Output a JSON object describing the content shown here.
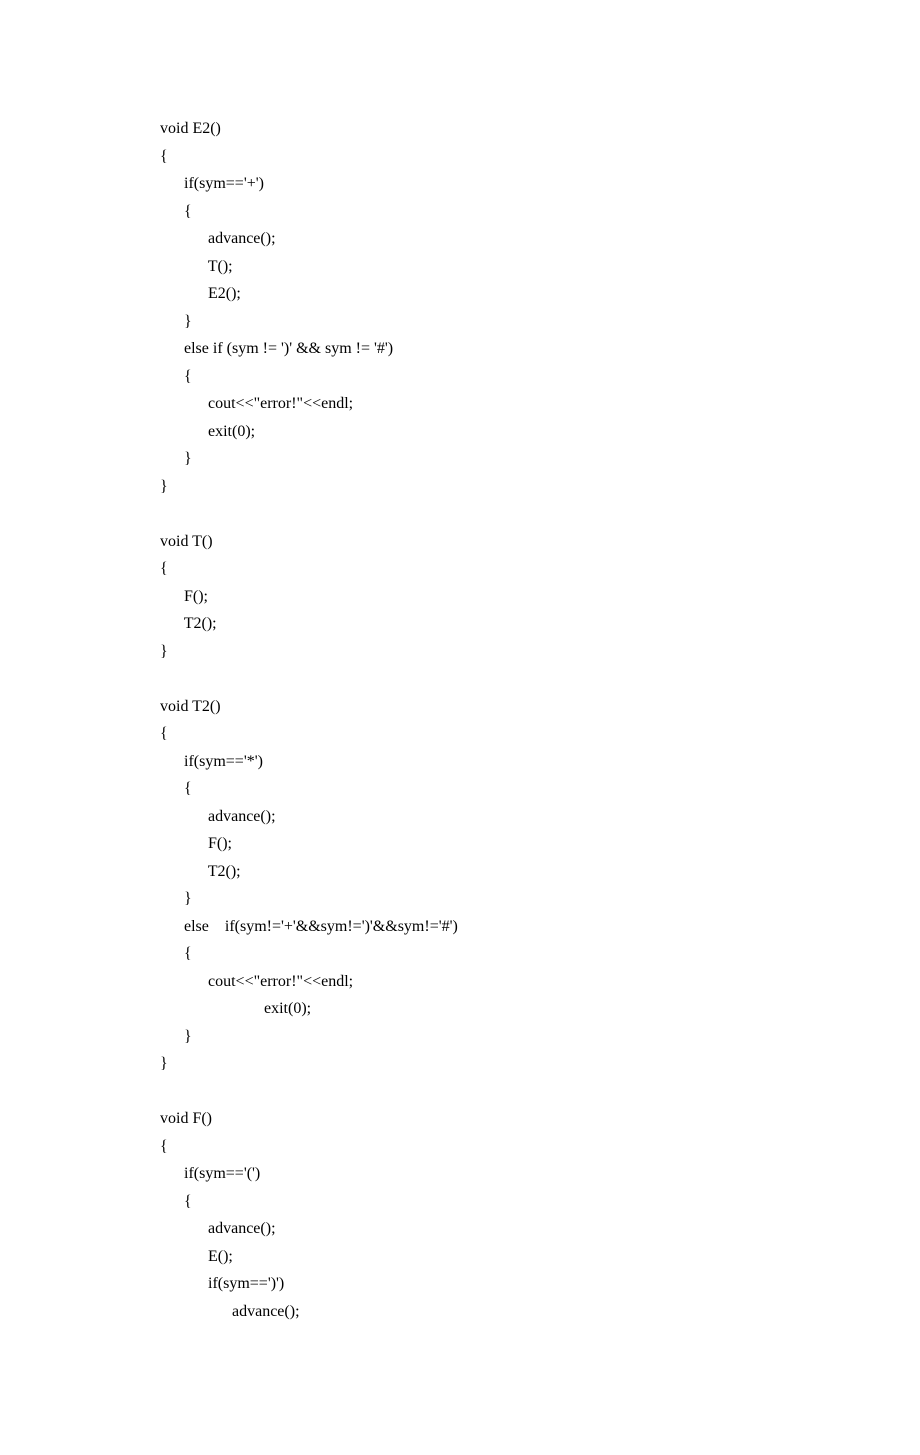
{
  "code": {
    "lines": [
      "void E2()",
      "{",
      "      if(sym=='+')",
      "      {",
      "            advance();",
      "            T();",
      "            E2();",
      "      }",
      "      else if (sym != ')' && sym != '#')",
      "      {",
      "            cout<<\"error!\"<<endl;",
      "            exit(0);",
      "      }",
      "}",
      "",
      "void T()",
      "{",
      "      F();",
      "      T2();",
      "}",
      "",
      "void T2()",
      "{",
      "      if(sym=='*')",
      "      {",
      "            advance();",
      "            F();",
      "            T2();",
      "      }",
      "      else    if(sym!='+'&&sym!=')'&&sym!='#')",
      "      {",
      "            cout<<\"error!\"<<endl;",
      "                          exit(0);",
      "      }",
      "}",
      "",
      "void F()",
      "{",
      "      if(sym=='(')",
      "      {",
      "            advance();",
      "            E();",
      "            if(sym==')')",
      "                  advance();"
    ]
  }
}
